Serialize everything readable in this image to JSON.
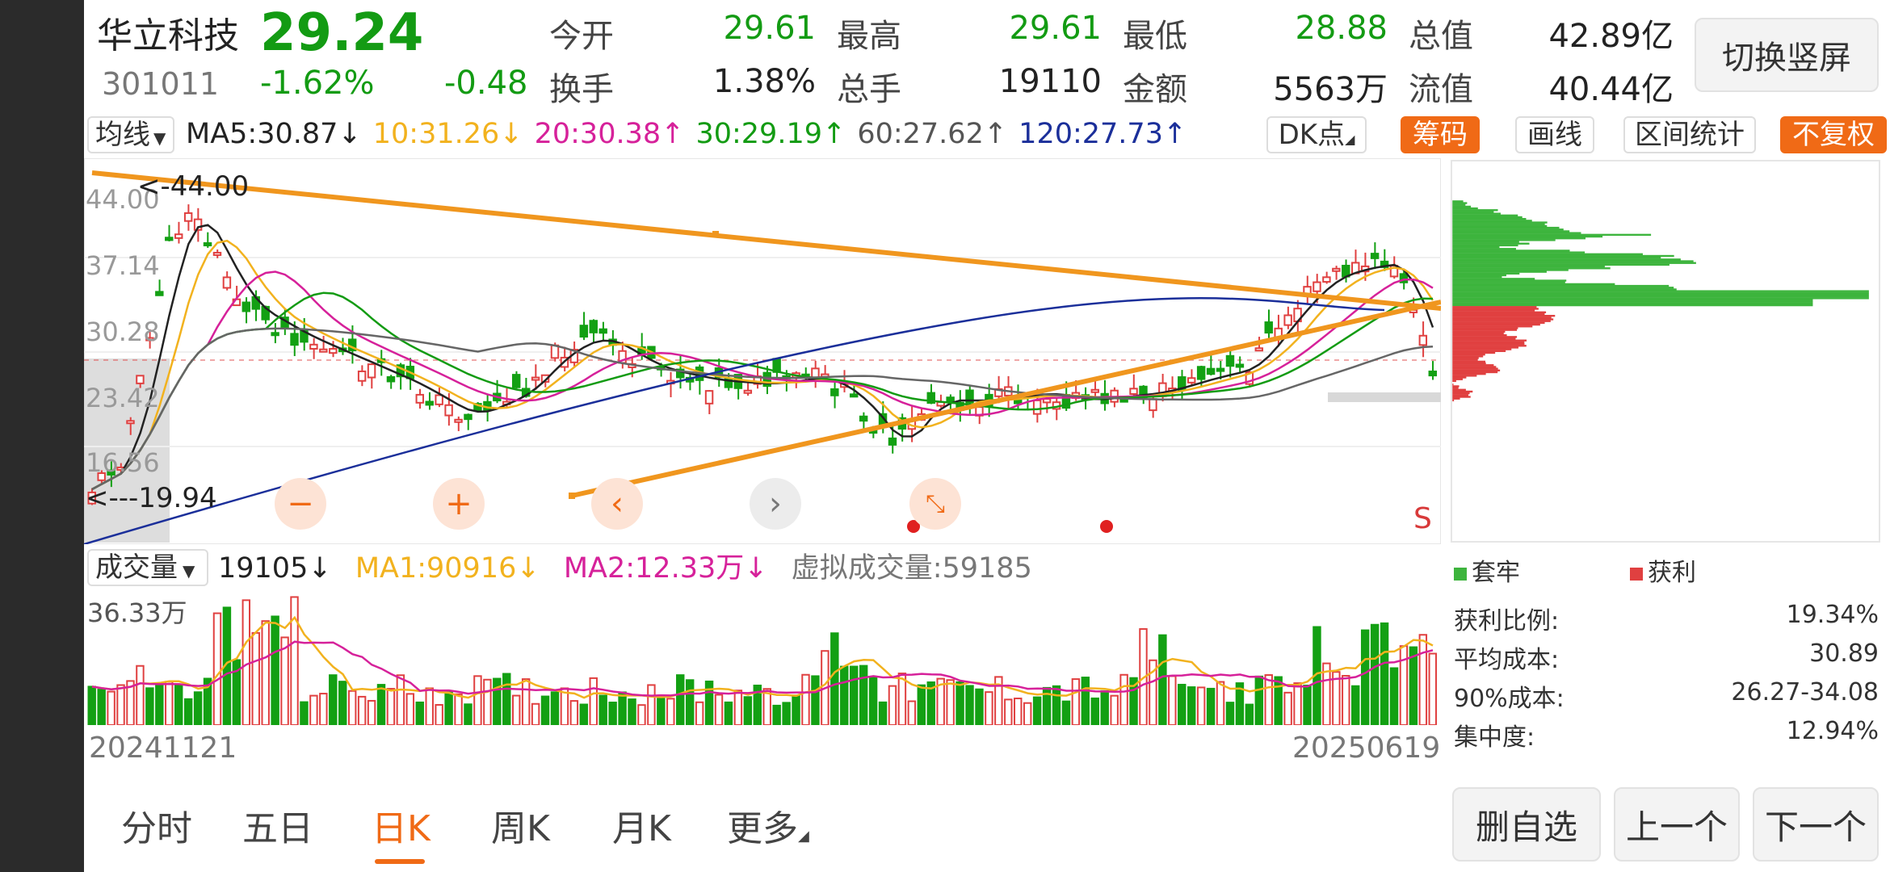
{
  "stock": {
    "name": "华立科技",
    "code": "301011",
    "price": "29.24",
    "change_pct": "-1.62%",
    "change": "-0.48",
    "switch_label": "切换竖屏"
  },
  "quote": [
    {
      "label": "今开",
      "value": "29.61"
    },
    {
      "label": "最高",
      "value": "29.61"
    },
    {
      "label": "最低",
      "value": "28.88"
    },
    {
      "label": "总值",
      "value": "42.89亿"
    },
    {
      "label": "换手",
      "value": "1.38%"
    },
    {
      "label": "总手",
      "value": "19110"
    },
    {
      "label": "金额",
      "value": "5563万"
    },
    {
      "label": "流值",
      "value": "40.44亿"
    }
  ],
  "toolbar": {
    "indicator_select": "均线",
    "ma": [
      {
        "text": "MA5:30.87↓",
        "color": "#222222"
      },
      {
        "text": "10:31.26↓",
        "color": "#f2b21e"
      },
      {
        "text": "20:30.38↑",
        "color": "#d6219a"
      },
      {
        "text": "30:29.19↑",
        "color": "#139b13"
      },
      {
        "text": "60:27.62↑",
        "color": "#555555"
      },
      {
        "text": "120:27.73↑",
        "color": "#1b2f9a"
      }
    ],
    "dk_label": "DK点",
    "chips_label": "筹码",
    "draw_label": "画线",
    "range_label": "区间统计",
    "fq_label": "不复权"
  },
  "kline": {
    "y_ticks": [
      "44.00",
      "37.14",
      "30.28",
      "23.42",
      "16.56"
    ],
    "high_mark": "<-44.00",
    "low_mark": "<---19.94",
    "signal": "S",
    "colors": {
      "up": "#e04040",
      "down": "#13a013",
      "trend": "#f0961e"
    }
  },
  "volume": {
    "select": "成交量",
    "value": "19105↓",
    "ma1": "MA1:90916↓",
    "ma2": "MA2:12.33万↓",
    "virtual": "虚拟成交量:59185",
    "max_tick": "36.33万",
    "date_start": "20241121",
    "date_end": "20250619"
  },
  "distribution": {
    "legend_trapped": "套牢",
    "legend_profit": "获利",
    "stats": [
      {
        "label": "获利比例:",
        "value": "19.34%"
      },
      {
        "label": "平均成本:",
        "value": "30.89"
      },
      {
        "label": "90%成本:",
        "value": "26.27-34.08"
      },
      {
        "label": "集中度:",
        "value": "12.94%"
      }
    ]
  },
  "tabs": [
    "分时",
    "五日",
    "日K",
    "周K",
    "月K",
    "更多"
  ],
  "active_tab": "日K",
  "buttons": {
    "delete_fav": "删自选",
    "prev": "上一个",
    "next": "下一个"
  }
}
